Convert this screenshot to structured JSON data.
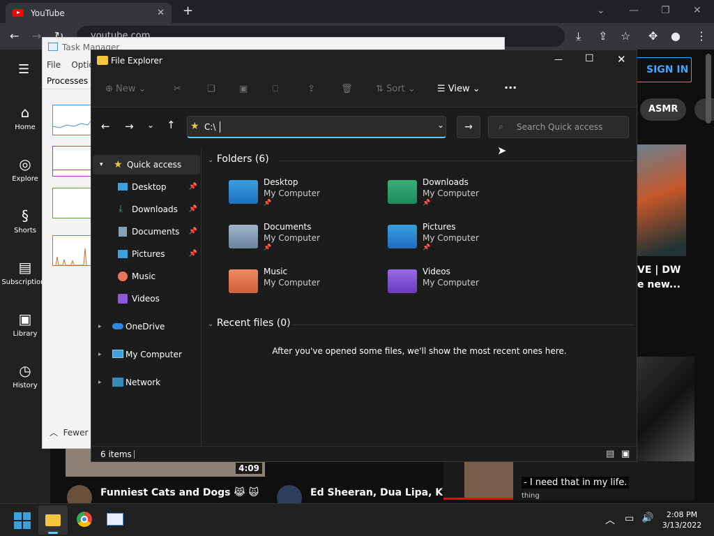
{
  "chrome": {
    "tab_title": "YouTube",
    "url": "youtube.com"
  },
  "youtube": {
    "nav": [
      {
        "label": "Home",
        "icon": "home-icon"
      },
      {
        "label": "Explore",
        "icon": "compass-icon"
      },
      {
        "label": "Shorts",
        "icon": "shorts-icon"
      },
      {
        "label": "Subscriptions",
        "icon": "subscriptions-icon"
      },
      {
        "label": "Library",
        "icon": "library-icon"
      },
      {
        "label": "History",
        "icon": "history-icon"
      }
    ],
    "signin": "SIGN IN",
    "chip": "ASMR",
    "video1": {
      "title": "Funniest Cats and Dogs 😹 🙀",
      "duration": "4:09"
    },
    "video2": {
      "title": "Ed Sheeran, Dua Lipa, Kygo, Av"
    },
    "right_title": "VE | DW",
    "right_title2": "e new...",
    "caption": "- I need that in my life.",
    "caption2": "thing"
  },
  "taskmanager": {
    "title": "Task Manager",
    "menu": [
      "File",
      "Optio"
    ],
    "tab": "Processes",
    "fewer": "Fewer"
  },
  "explorer": {
    "title": "File Explorer",
    "cmd": {
      "new": "New",
      "sort": "Sort",
      "view": "View"
    },
    "address": "C:\\",
    "search_placeholder": "Search Quick access",
    "nav": {
      "quick": "Quick access",
      "items": [
        "Desktop",
        "Downloads",
        "Documents",
        "Pictures",
        "Music",
        "Videos"
      ],
      "onedrive": "OneDrive",
      "mycomputer": "My Computer",
      "network": "Network"
    },
    "folders_header": "Folders (6)",
    "folders": [
      {
        "name": "Desktop",
        "sub": "My Computer",
        "pinned": true
      },
      {
        "name": "Downloads",
        "sub": "My Computer",
        "pinned": true
      },
      {
        "name": "Documents",
        "sub": "My Computer",
        "pinned": true
      },
      {
        "name": "Pictures",
        "sub": "My Computer",
        "pinned": true
      },
      {
        "name": "Music",
        "sub": "My Computer",
        "pinned": false
      },
      {
        "name": "Videos",
        "sub": "My Computer",
        "pinned": false
      }
    ],
    "recent_header": "Recent files (0)",
    "recent_empty": "After you've opened some files, we'll show the most recent ones here.",
    "status": "6 items"
  },
  "taskbar": {
    "time": "2:08 PM",
    "date": "3/13/2022"
  },
  "colors": {
    "accent": "#60cdff",
    "youtube_red": "#ff0000",
    "signin_blue": "#3ea6ff"
  }
}
